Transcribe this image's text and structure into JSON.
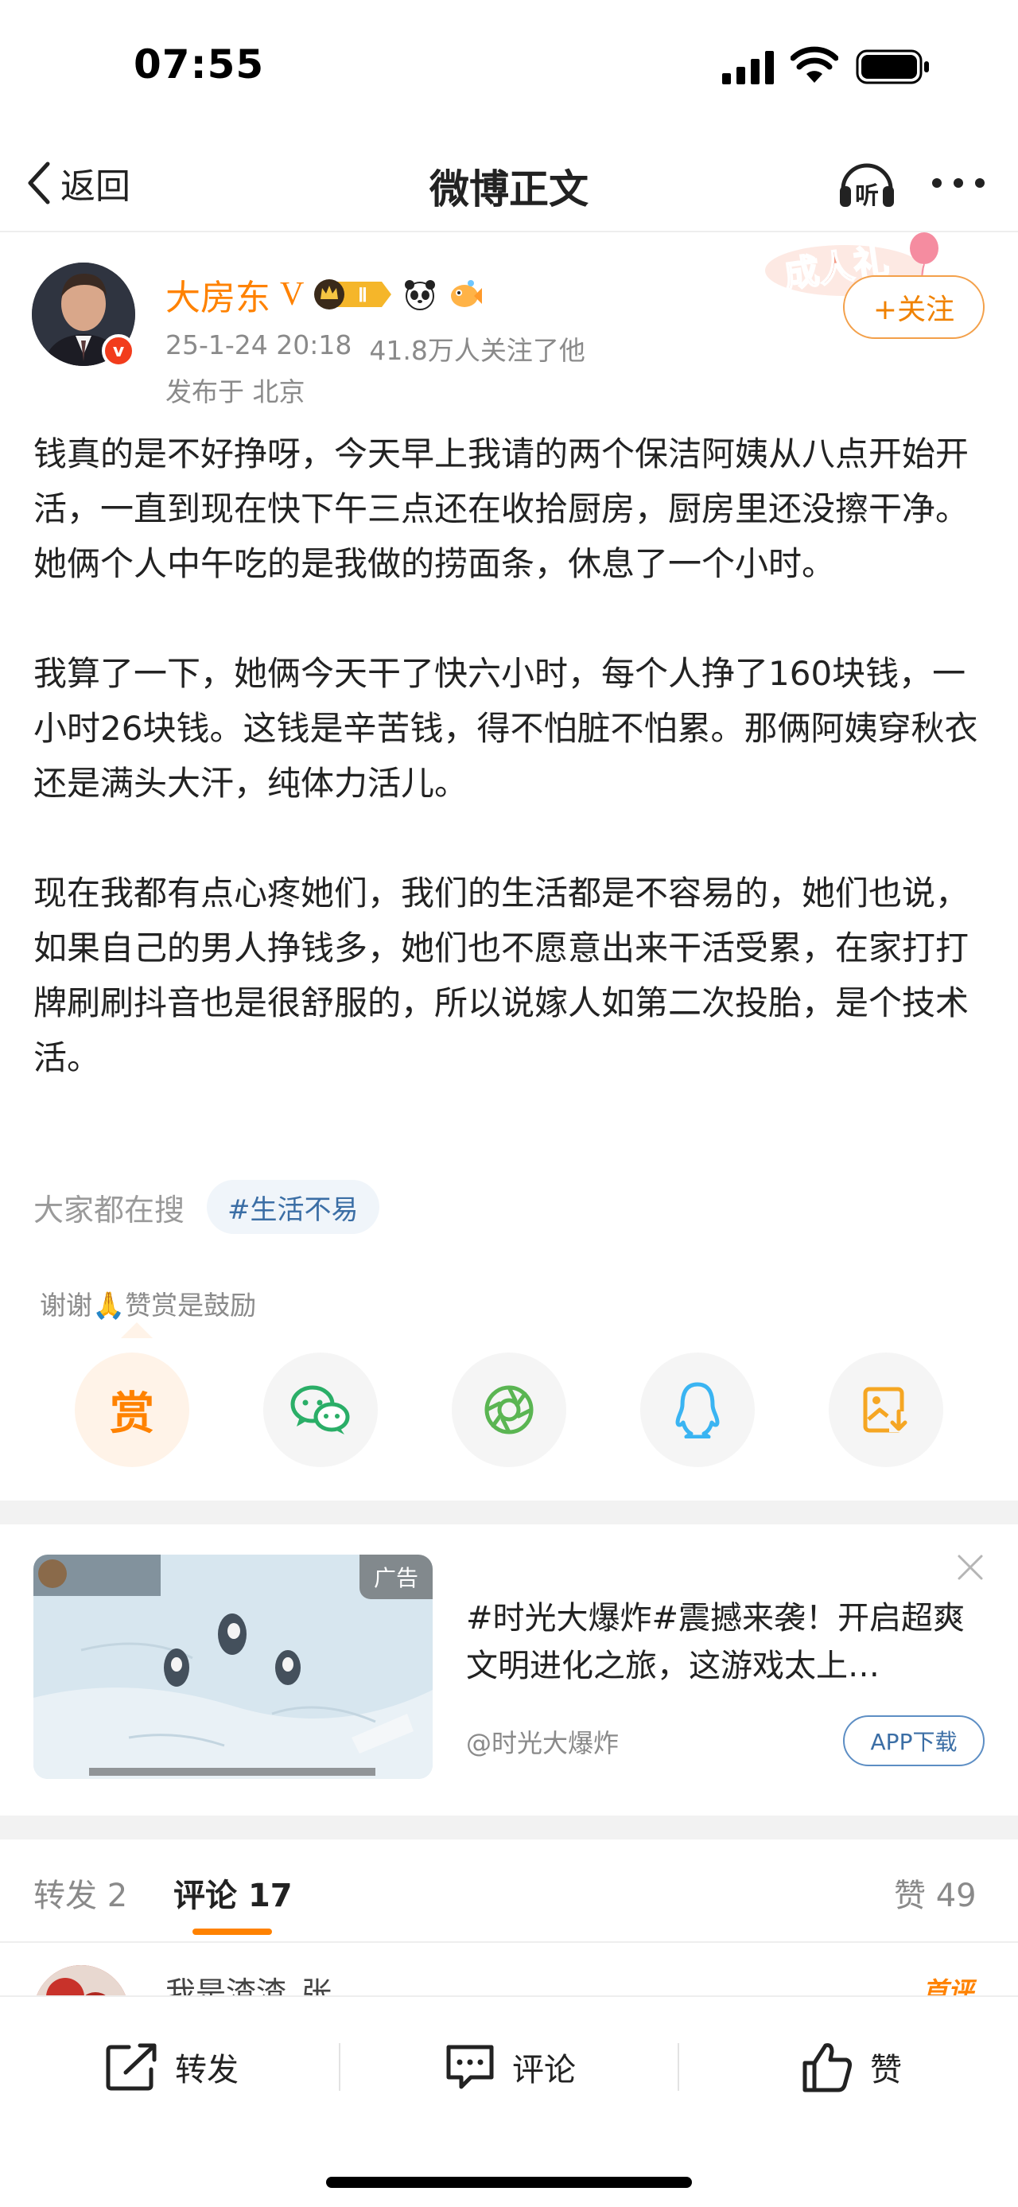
{
  "status_bar": {
    "time": "07:55"
  },
  "nav": {
    "back_label": "返回",
    "title": "微博正文",
    "listen_glyph": "听"
  },
  "author": {
    "name": "大房东",
    "v_mark": "V",
    "level": "Ⅱ",
    "verified_glyph": "v",
    "meta_time": "25-1-24 20:18",
    "meta_followers": "41.8万人关注了他",
    "location": "发布于 北京",
    "promo_sticker_text": "成人礼",
    "follow_label": "+关注"
  },
  "post": {
    "paragraphs": [
      "钱真的是不好挣呀，今天早上我请的两个保洁阿姨从八点开始开活，一直到现在快下午三点还在收拾厨房，厨房里还没擦干净。她俩个人中午吃的是我做的捞面条，休息了一个小时。",
      "我算了一下，她俩今天干了快六小时，每个人挣了160块钱，一小时26块钱。这钱是辛苦钱，得不怕脏不怕累。那俩阿姨穿秋衣还是满头大汗，纯体力活儿。",
      "现在我都有点心疼她们，我们的生活都是不容易的，她们也说，如果自己的男人挣钱多，她们也不愿意出来干活受累，在家打打牌刷刷抖音也是很舒服的，所以说嫁人如第二次投胎，是个技术活。"
    ]
  },
  "search": {
    "label": "大家都在搜",
    "tag": "#生活不易"
  },
  "reward": {
    "note_before": "谢谢",
    "note_emoji": "🙏",
    "note_after": "赞赏是鼓励",
    "button_glyph": "赏"
  },
  "share_icons": [
    "reward-icon",
    "wechat-icon",
    "moments-icon",
    "qq-icon",
    "save-image-icon"
  ],
  "ad": {
    "tag": "广告",
    "text": "#时光大爆炸#震撼来袭！开启超爽文明进化之旅，这游戏太上…",
    "advertiser": "@时光大爆炸",
    "download_label": "APP下载"
  },
  "tabs": {
    "repost_label": "转发",
    "repost_count": "2",
    "comment_label": "评论",
    "comment_count": "17",
    "like_label": "赞",
    "like_count": "49"
  },
  "comment_preview": {
    "user": "我是渣渣_张",
    "tag": "首评"
  },
  "bottom_bar": {
    "repost": "转发",
    "comment": "评论",
    "like": "赞"
  },
  "colors": {
    "accent": "#ff8200",
    "link": "#3b6ea5",
    "wechat": "#2aae67",
    "moments": "#5ab552",
    "qq": "#3ab4f2",
    "save": "#f5a623"
  }
}
